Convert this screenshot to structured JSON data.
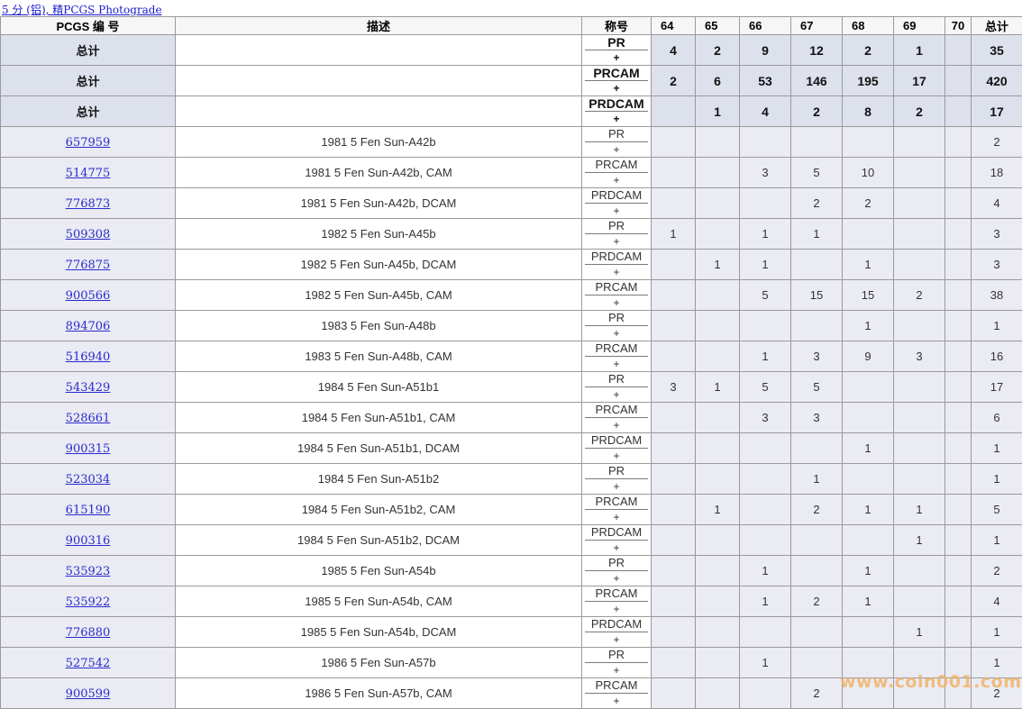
{
  "header_link": "5 分 (铝), 精PCGS Photograde",
  "columns": {
    "pcgs": "PCGS 编 号",
    "desc": "描述",
    "desig": "称号",
    "grades": [
      "64",
      "65",
      "66",
      "67",
      "68",
      "69",
      "70"
    ],
    "total": "总计"
  },
  "plus_sign": "+",
  "totals": [
    {
      "label": "总计",
      "desig": "PR",
      "counts": [
        "4",
        "2",
        "9",
        "12",
        "2",
        "1",
        ""
      ],
      "total": "35"
    },
    {
      "label": "总计",
      "desig": "PRCAM",
      "counts": [
        "2",
        "6",
        "53",
        "146",
        "195",
        "17",
        ""
      ],
      "total": "420"
    },
    {
      "label": "总计",
      "desig": "PRDCAM",
      "counts": [
        "",
        "1",
        "4",
        "2",
        "8",
        "2",
        ""
      ],
      "total": "17"
    }
  ],
  "rows": [
    {
      "pcgs": "657959",
      "desc": "1981 5 Fen Sun-A42b",
      "desig": "PR",
      "counts": [
        "",
        "",
        "",
        "",
        "",
        "",
        ""
      ],
      "total": "2"
    },
    {
      "pcgs": "514775",
      "desc": "1981 5 Fen Sun-A42b, CAM",
      "desig": "PRCAM",
      "counts": [
        "",
        "",
        "3",
        "5",
        "10",
        "",
        ""
      ],
      "total": "18"
    },
    {
      "pcgs": "776873",
      "desc": "1981 5 Fen Sun-A42b, DCAM",
      "desig": "PRDCAM",
      "counts": [
        "",
        "",
        "",
        "2",
        "2",
        "",
        ""
      ],
      "total": "4"
    },
    {
      "pcgs": "509308",
      "desc": "1982 5 Fen Sun-A45b",
      "desig": "PR",
      "counts": [
        "1",
        "",
        "1",
        "1",
        "",
        "",
        ""
      ],
      "total": "3"
    },
    {
      "pcgs": "776875",
      "desc": "1982 5 Fen Sun-A45b, DCAM",
      "desig": "PRDCAM",
      "counts": [
        "",
        "1",
        "1",
        "",
        "1",
        "",
        ""
      ],
      "total": "3"
    },
    {
      "pcgs": "900566",
      "desc": "1982 5 Fen Sun-A45b, CAM",
      "desig": "PRCAM",
      "counts": [
        "",
        "",
        "5",
        "15",
        "15",
        "2",
        ""
      ],
      "total": "38"
    },
    {
      "pcgs": "894706",
      "desc": "1983 5 Fen Sun-A48b",
      "desig": "PR",
      "counts": [
        "",
        "",
        "",
        "",
        "1",
        "",
        ""
      ],
      "total": "1"
    },
    {
      "pcgs": "516940",
      "desc": "1983 5 Fen Sun-A48b, CAM",
      "desig": "PRCAM",
      "counts": [
        "",
        "",
        "1",
        "3",
        "9",
        "3",
        ""
      ],
      "total": "16"
    },
    {
      "pcgs": "543429",
      "desc": "1984 5 Fen Sun-A51b1",
      "desig": "PR",
      "counts": [
        "3",
        "1",
        "5",
        "5",
        "",
        "",
        ""
      ],
      "total": "17"
    },
    {
      "pcgs": "528661",
      "desc": "1984 5 Fen Sun-A51b1, CAM",
      "desig": "PRCAM",
      "counts": [
        "",
        "",
        "3",
        "3",
        "",
        "",
        ""
      ],
      "total": "6"
    },
    {
      "pcgs": "900315",
      "desc": "1984 5 Fen Sun-A51b1, DCAM",
      "desig": "PRDCAM",
      "counts": [
        "",
        "",
        "",
        "",
        "1",
        "",
        ""
      ],
      "total": "1"
    },
    {
      "pcgs": "523034",
      "desc": "1984 5 Fen Sun-A51b2",
      "desig": "PR",
      "counts": [
        "",
        "",
        "",
        "1",
        "",
        "",
        ""
      ],
      "total": "1"
    },
    {
      "pcgs": "615190",
      "desc": "1984 5 Fen Sun-A51b2, CAM",
      "desig": "PRCAM",
      "counts": [
        "",
        "1",
        "",
        "2",
        "1",
        "1",
        ""
      ],
      "total": "5"
    },
    {
      "pcgs": "900316",
      "desc": "1984 5 Fen Sun-A51b2, DCAM",
      "desig": "PRDCAM",
      "counts": [
        "",
        "",
        "",
        "",
        "",
        "1",
        ""
      ],
      "total": "1"
    },
    {
      "pcgs": "535923",
      "desc": "1985 5 Fen Sun-A54b",
      "desig": "PR",
      "counts": [
        "",
        "",
        "1",
        "",
        "1",
        "",
        ""
      ],
      "total": "2"
    },
    {
      "pcgs": "535922",
      "desc": "1985 5 Fen Sun-A54b, CAM",
      "desig": "PRCAM",
      "counts": [
        "",
        "",
        "1",
        "2",
        "1",
        "",
        ""
      ],
      "total": "4"
    },
    {
      "pcgs": "776880",
      "desc": "1985 5 Fen Sun-A54b, DCAM",
      "desig": "PRDCAM",
      "counts": [
        "",
        "",
        "",
        "",
        "",
        "1",
        ""
      ],
      "total": "1"
    },
    {
      "pcgs": "527542",
      "desc": "1986 5 Fen Sun-A57b",
      "desig": "PR",
      "counts": [
        "",
        "",
        "1",
        "",
        "",
        "",
        ""
      ],
      "total": "1"
    },
    {
      "pcgs": "900599",
      "desc": "1986 5 Fen Sun-A57b, CAM",
      "desig": "PRCAM",
      "counts": [
        "",
        "",
        "",
        "2",
        "",
        "",
        ""
      ],
      "total": "2"
    }
  ],
  "watermark": "www.coin001.com"
}
